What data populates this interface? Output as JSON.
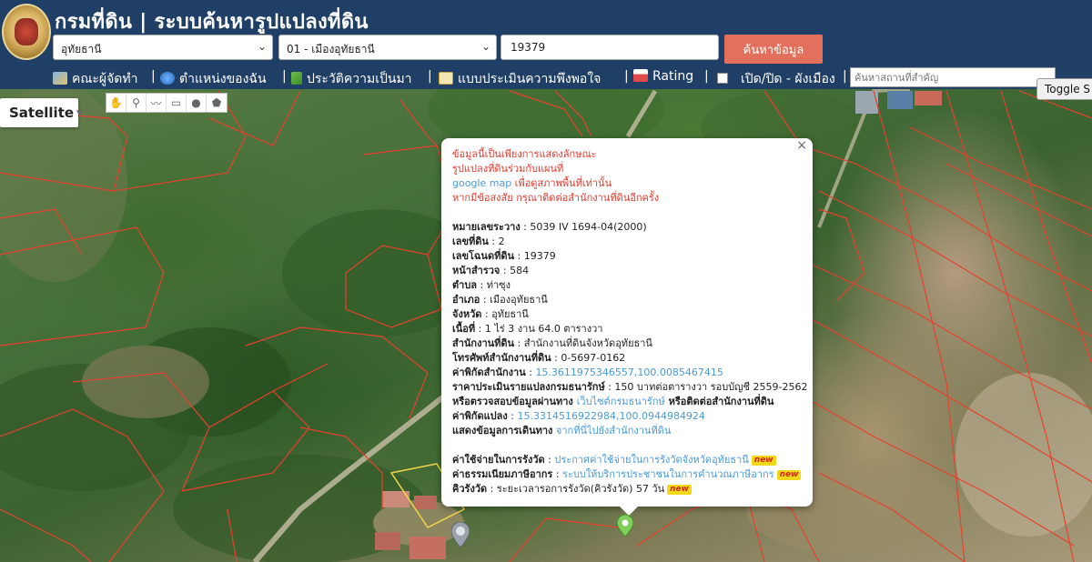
{
  "header": {
    "title": "กรมที่ดิน | ระบบค้นหารูปแปลงที่ดิน",
    "province": "อุทัยธานี",
    "district": "01 - เมืองอุทัยธานี",
    "parcel_no": "19379",
    "search_label": "ค้นหาข้อมูล"
  },
  "nav": {
    "items": [
      {
        "label": "คณะผู้จัดทำ",
        "icon": "map-icon"
      },
      {
        "label": "ตำแหน่งของฉัน",
        "icon": "globe-icon"
      },
      {
        "label": "ประวัติความเป็นมา",
        "icon": "sprout-icon"
      },
      {
        "label": "แบบประเมินความพึงพอใจ",
        "icon": "memo-icon"
      },
      {
        "label": "Rating",
        "icon": "chart-icon"
      }
    ],
    "layer_toggle_label": "เปิด/ปิด - ผังเมือง",
    "place_placeholder": "ค้นหาสถานที่สำคัญ"
  },
  "toggle_button": "Toggle S",
  "map": {
    "type_label": "Satellite",
    "tools": [
      "hand-icon",
      "pin-icon",
      "polyline-icon",
      "rectangle-icon",
      "circle-icon",
      "pentagon-icon"
    ]
  },
  "popup": {
    "disclaimer": [
      "ข้อมูลนี้เป็นเพียงการแสดงลักษณะ",
      "รูปแปลงที่ดินร่วมกับแผนที่",
      "google map",
      " เพื่อดูสภาพพื้นที่เท่านั้น",
      "หากมีข้อสงสัย กรุณาติดต่อสำนักงานที่ดินอีกครั้ง"
    ],
    "fields": {
      "survey_sheet": {
        "label": "หมายเลขระวาง",
        "value": "5039 IV 1694-04(2000)"
      },
      "land_no": {
        "label": "เลขที่ดิน",
        "value": "2"
      },
      "deed_no": {
        "label": "เลขโฉนดที่ดิน",
        "value": "19379"
      },
      "survey_page": {
        "label": "หน้าสำรวจ",
        "value": "584"
      },
      "subdistrict": {
        "label": "ตำบล",
        "value": "ท่าซุง"
      },
      "district": {
        "label": "อำเภอ",
        "value": "เมืองอุทัยธานี"
      },
      "province": {
        "label": "จังหวัด",
        "value": "อุทัยธานี"
      },
      "area": {
        "label": "เนื้อที่",
        "value": "1 ไร่ 3 งาน 64.0 ตารางวา"
      },
      "office": {
        "label": "สำนักงานที่ดิน",
        "value": "สำนักงานที่ดินจังหวัดอุทัยธานี"
      },
      "phone": {
        "label": "โทรศัพท์สำนักงานที่ดิน",
        "value": "0-5697-0162"
      },
      "office_coords": {
        "label": "ค่าพิกัดสำนักงาน",
        "value": "15.3611975346557,100.0085467415"
      },
      "appraisal": {
        "label": "ราคาประเมินรายแปลงกรมธนารักษ์",
        "value": "150 บาทต่อตารางวา รอบบัญชี 2559-2562"
      },
      "verify": {
        "prefix": "หรือตรวจสอบข้อมูลผ่านทาง ",
        "link": "เว็บไซต์กรมธนารักษ์",
        "suffix": " หรือติดต่อสำนักงานที่ดิน"
      },
      "parcel_coords": {
        "label": "ค่าพิกัดแปลง",
        "value": "15.3314516922984,100.0944984924"
      },
      "route": {
        "label": "แสดงข้อมูลการเดินทาง",
        "link": "จากที่นี่ไปยังสำนักงานที่ดิน"
      },
      "survey_cost": {
        "label": "ค่าใช้จ่ายในการรังวัด",
        "link": "ประกาศค่าใช้จ่ายในการรังวัดจังหวัดอุทัยธานี"
      },
      "fee": {
        "label": "ค่าธรรมเนียมภาษีอากร",
        "link": "ระบบให้บริการประชาชนในการคำนวณภาษีอากร"
      },
      "queue": {
        "label": "คิวรังวัด",
        "value": "ระยะเวลารอการรังวัด(คิวรังวัด) 57 วัน"
      }
    },
    "new_badge": "new"
  }
}
